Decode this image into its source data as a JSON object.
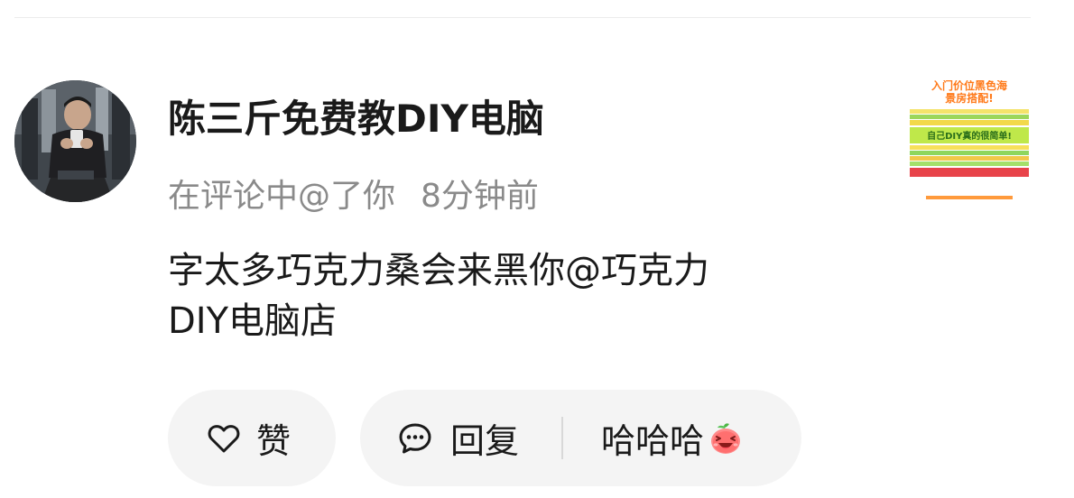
{
  "notification": {
    "username": "陈三斤免费教DIY电脑",
    "action": "在评论中@了你",
    "time": "8分钟前",
    "comment_line1": "字太多巧克力桑会来黑你@巧克力",
    "comment_line2": "DIY电脑店",
    "avatar_icon": "user-avatar-photo",
    "thumbnail": {
      "icon": "post-thumbnail-image",
      "lines": [
        "入门价位黑色海",
        "景房搭配!",
        "自己DIY真的很简单!"
      ]
    }
  },
  "actions": {
    "like_label": "赞",
    "like_icon": "heart-outline-icon",
    "reply_label": "回复",
    "reply_icon": "comment-bubble-icon",
    "quick_reply_label": "哈哈哈",
    "quick_reply_icon": "laughing-peach-emoji"
  },
  "colors": {
    "text_primary": "#1a1a1a",
    "text_secondary": "#8a8a8a",
    "pill_bg": "#f4f4f4"
  }
}
